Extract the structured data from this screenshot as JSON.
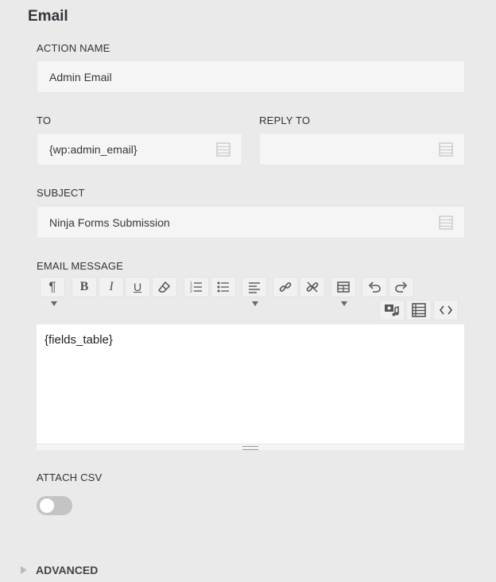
{
  "section_title": "Email",
  "action_name": {
    "label": "ACTION NAME",
    "value": "Admin Email"
  },
  "to": {
    "label": "TO",
    "value": "{wp:admin_email}"
  },
  "reply_to": {
    "label": "REPLY TO",
    "value": ""
  },
  "subject": {
    "label": "SUBJECT",
    "value": "Ninja Forms Submission"
  },
  "email_message": {
    "label": "EMAIL MESSAGE",
    "content": "{fields_table}",
    "toolbar_icons": [
      "paragraph-icon",
      "bold-icon",
      "italic-icon",
      "underline-icon",
      "eraser-icon",
      "ordered-list-icon",
      "unordered-list-icon",
      "align-left-icon",
      "link-icon",
      "unlink-icon",
      "table-icon",
      "undo-icon",
      "redo-icon",
      "media-icon",
      "merge-tags-icon",
      "code-icon"
    ]
  },
  "attach_csv": {
    "label": "ATTACH CSV",
    "enabled": false
  },
  "advanced": {
    "label": "ADVANCED"
  }
}
